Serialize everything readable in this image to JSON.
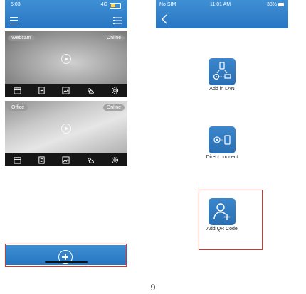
{
  "left_phone": {
    "status": {
      "time": "5:03",
      "signal": "4G"
    },
    "cameras": [
      {
        "name": "Webcam",
        "status": "Online"
      },
      {
        "name": "Office",
        "status": "Online"
      }
    ],
    "toolbar_icons": [
      "calendar-icon",
      "document-icon",
      "image-icon",
      "weather-icon",
      "settings-icon"
    ],
    "bottom_bar": {
      "add_icon": "plus-circle-icon"
    }
  },
  "right_phone": {
    "status": {
      "carrier": "No SIM",
      "time": "11:01 AM",
      "battery": "38%"
    },
    "options": [
      {
        "label": "Add in LAN",
        "icon": "lan-camera-icon"
      },
      {
        "label": "Direct connect",
        "icon": "direct-connect-icon"
      },
      {
        "label": "Add QR Code",
        "icon": "add-user-icon"
      }
    ]
  },
  "page_number": "9",
  "colors": {
    "header_blue": "#2f7fca",
    "highlight_red": "#e0302b"
  }
}
